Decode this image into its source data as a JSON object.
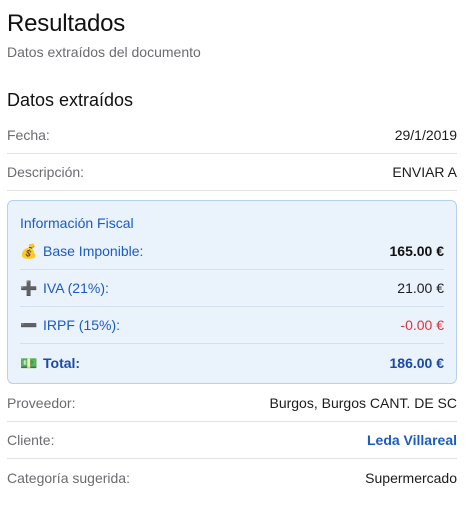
{
  "header": {
    "title": "Resultados",
    "subtitle": "Datos extraídos del documento"
  },
  "section": {
    "title": "Datos extraídos"
  },
  "fields": {
    "fecha": {
      "label": "Fecha:",
      "value": "29/1/2019"
    },
    "descripcion": {
      "label": "Descripción:",
      "value": "ENVIAR A"
    },
    "proveedor": {
      "label": "Proveedor:",
      "value": "Burgos, Burgos CANT. DE SC"
    },
    "cliente": {
      "label": "Cliente:",
      "value": "Leda Villareal"
    },
    "categoria": {
      "label": "Categoría sugerida:",
      "value": "Supermercado"
    }
  },
  "fiscal": {
    "title": "Información Fiscal",
    "rows": [
      {
        "icon": "money-bag-icon",
        "glyph": "💰",
        "label": "Base Imponible:",
        "value": "165.00 €"
      },
      {
        "icon": "plus-icon",
        "glyph": "➕",
        "label": "IVA (21%):",
        "value": "21.00 €"
      },
      {
        "icon": "minus-icon",
        "glyph": "➖",
        "label": "IRPF (15%):",
        "value": "-0.00 €"
      },
      {
        "icon": "banknote-icon",
        "glyph": "💵",
        "label": "Total:",
        "value": "186.00 €"
      }
    ]
  },
  "colors": {
    "accent": "#1a5bc4",
    "negative": "#d8343a",
    "fiscal_bg": "#eaf2fc",
    "fiscal_border": "#b8d0f0"
  }
}
